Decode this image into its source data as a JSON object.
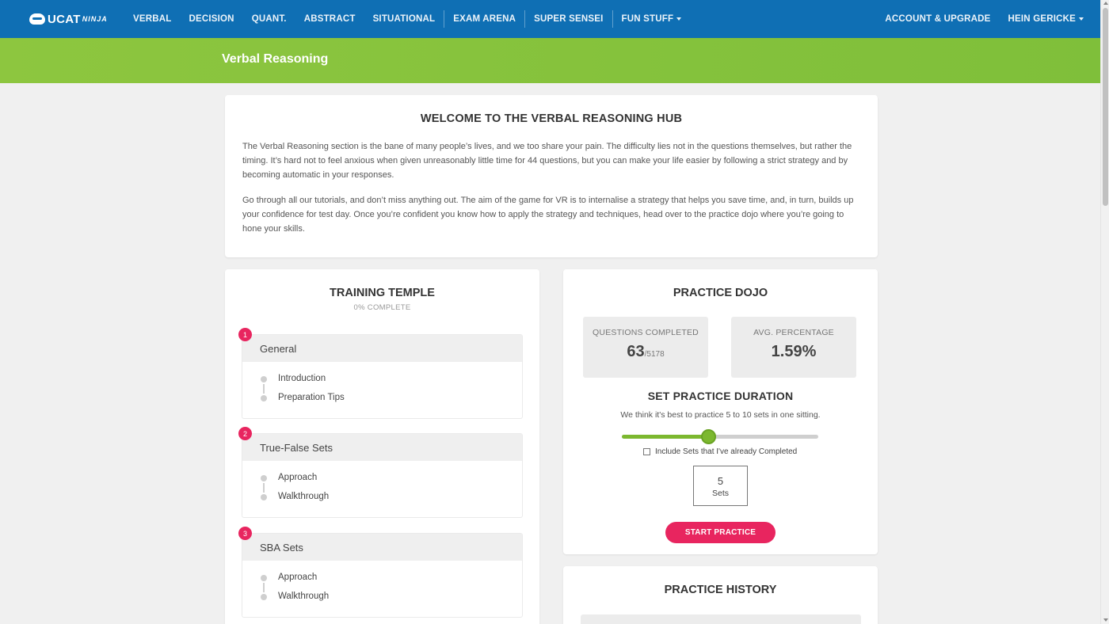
{
  "nav": {
    "logo": "UCAT",
    "logo_sub": "NINJA",
    "items": [
      "VERBAL",
      "DECISION",
      "QUANT.",
      "ABSTRACT",
      "SITUATIONAL"
    ],
    "items2": [
      "EXAM ARENA"
    ],
    "items3": [
      "SUPER SENSEI"
    ],
    "fun": "FUN STUFF",
    "account": "ACCOUNT & UPGRADE",
    "user": "HEIN GERICKE"
  },
  "page_title": "Verbal Reasoning",
  "welcome": {
    "title": "WELCOME TO THE VERBAL REASONING HUB",
    "p1": "The Verbal Reasoning section is the bane of many people’s lives, and we too share your pain. The difficulty lies not in the questions themselves, but rather the timing. It’s hard not to feel anxious when given unreasonably little time for 44 questions, but you can make your life easier by following a strict strategy and by becoming automatic in your responses.",
    "p2": "Go through all our tutorials, and don’t miss anything out. The aim of the game for VR is to internalise a strategy that helps you save time, and, in turn, builds up your confidence for test day. Once you’re confident you know how to apply the strategy and techniques, head over to the practice dojo where you’re going to hone your skills."
  },
  "temple": {
    "title": "TRAINING TEMPLE",
    "complete": "0% COMPLETE",
    "modules": [
      {
        "num": "1",
        "title": "General",
        "lessons": [
          "Introduction",
          "Preparation Tips"
        ]
      },
      {
        "num": "2",
        "title": "True-False Sets",
        "lessons": [
          "Approach",
          "Walkthrough"
        ]
      },
      {
        "num": "3",
        "title": "SBA Sets",
        "lessons": [
          "Approach",
          "Walkthrough"
        ]
      }
    ]
  },
  "dojo": {
    "title": "PRACTICE DOJO",
    "questions_label": "QUESTIONS COMPLETED",
    "questions_value": "63",
    "questions_total": "/5178",
    "avg_label": "AVG. PERCENTAGE",
    "avg_value": "1.59%",
    "duration_title": "SET PRACTICE DURATION",
    "hint": "We think it's best to practice 5 to 10 sets in one sitting.",
    "slider_value": 0.44,
    "include_label": "Include Sets that I've already Completed",
    "sets_number": "5",
    "sets_label": "Sets",
    "start_label": "START PRACTICE"
  },
  "history": {
    "title": "PRACTICE HISTORY"
  },
  "colors": {
    "nav": "#0f6fb4",
    "green": "#8dc63f",
    "accent": "#e8255f"
  }
}
